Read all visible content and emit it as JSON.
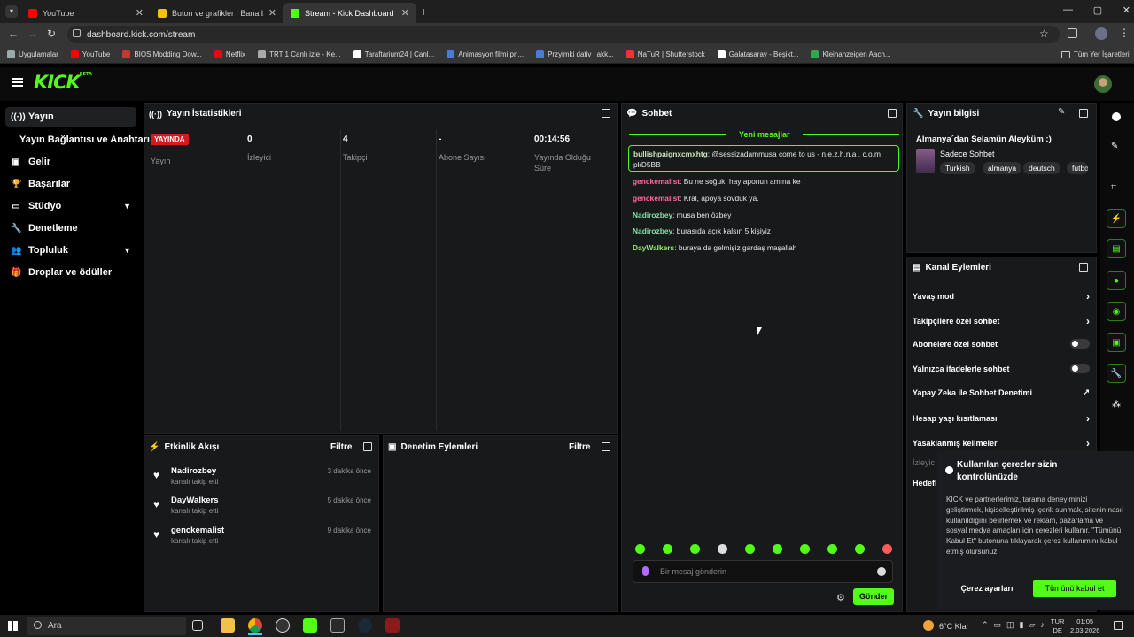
{
  "browser": {
    "tabs": [
      {
        "title": "YouTube",
        "active": false,
        "color": "#ff0000"
      },
      {
        "title": "Buton ve grafikler | Bana bir kal",
        "active": false,
        "color": "#f5c400"
      },
      {
        "title": "Stream - Kick Dashboard",
        "active": true,
        "color": "#53fc18"
      }
    ],
    "url": "dashboard.kick.com/stream",
    "bookmarks": [
      "Uygulamalar",
      "YouTube",
      "BIOS Modding Dow...",
      "Netflix",
      "TRT 1 Canlı izle - Ke...",
      "Taraftarium24 | Canl...",
      "Animasyon filmi pn...",
      "Przyimki dativ i akk...",
      "NaTuR | Shutterstock",
      "Galatasaray - Beşikt...",
      "Kleinanzeigen Aach..."
    ],
    "all_bookmarks": "Tüm Yer İşaretleri"
  },
  "header": {
    "logo": "KICK",
    "logo_badge": "BETA"
  },
  "sidebar": {
    "items": [
      {
        "label": "Yayın",
        "icon": "broadcast-icon",
        "active": true
      },
      {
        "label": "Yayın Bağlantısı ve Anahtarı",
        "icon": "",
        "active": false
      },
      {
        "label": "Gelir",
        "icon": "chart-icon",
        "active": false
      },
      {
        "label": "Başarılar",
        "icon": "trophy-icon",
        "active": false
      },
      {
        "label": "Stüdyo",
        "icon": "studio-icon",
        "active": false,
        "chevron": true
      },
      {
        "label": "Denetleme",
        "icon": "wrench-icon",
        "active": false
      },
      {
        "label": "Topluluk",
        "icon": "community-icon",
        "active": false,
        "chevron": true
      },
      {
        "label": "Droplar ve ödüller",
        "icon": "gift-icon",
        "active": false
      }
    ]
  },
  "stats": {
    "title": "Yayın İstatistikleri",
    "live_badge": "YAYINDA",
    "cols": [
      {
        "value": "",
        "label": "Yayın"
      },
      {
        "value": "0",
        "label": "İzleyici"
      },
      {
        "value": "4",
        "label": "Takipçi"
      },
      {
        "value": "-",
        "label": "Abone Sayısı"
      },
      {
        "value": "00:14:56",
        "label": "Yayında Olduğu Süre"
      }
    ]
  },
  "chat": {
    "title": "Sohbet",
    "new_messages": "Yeni mesajlar",
    "highlight": {
      "user": "bullishpaignxcmxhtg",
      "text": ": @sessizadammusa come to us - n.e.z.h.n.a . c.o.m",
      "text2": "pkD5BB"
    },
    "messages": [
      {
        "user": "genckemalist",
        "text": ": Bu ne soğuk, hay aponun amına ke",
        "color": "#ff6b9d"
      },
      {
        "user": "genckemalist",
        "text": ": Kral, apoya sövdük ya.",
        "color": "#ff6b9d"
      },
      {
        "user": "Nadirozbey",
        "text": ": musa ben özbey",
        "color": "#7ee3a8"
      },
      {
        "user": "Nadirozbey",
        "text": ": burasıda açık kalsın 5 kişiyiz",
        "color": "#7ee3a8"
      },
      {
        "user": "DayWalkers",
        "text": ": buraya da gelmişiz gardaş maşallah",
        "color": "#9cf26a"
      }
    ],
    "placeholder": "Bir mesaj gönderin",
    "send": "Gönder"
  },
  "info": {
    "title": "Yayın bilgisi",
    "stream_title": "Almanya´dan Selamün Aleyküm :)",
    "category": "Sadece Sohbet",
    "tags": [
      "Turkish",
      "almanya",
      "deutsch",
      "futbo"
    ]
  },
  "actions": {
    "title": "Kanal Eylemleri",
    "rows": [
      {
        "label": "Yavaş mod",
        "kind": "chevron"
      },
      {
        "label": "Takipçilere özel sohbet",
        "kind": "chevron"
      },
      {
        "label": "Abonelere özel sohbet",
        "kind": "toggle"
      },
      {
        "label": "Yalnızca ifadelerle sohbet",
        "kind": "toggle"
      },
      {
        "label": "Yapay Zeka ile Sohbet Denetimi",
        "kind": "external"
      },
      {
        "label": "Hesap yaşı kısıtlaması",
        "kind": "chevron"
      },
      {
        "label": "Yasaklanmış kelimeler",
        "kind": "chevron"
      }
    ],
    "partial1": "İzleyic",
    "partial2": "Hedefl"
  },
  "activity": {
    "title": "Etkinlik Akışı",
    "filter": "Filtre",
    "events": [
      {
        "user": "Nadirozbey",
        "sub": "kanalı takip etti",
        "time": "3 dakika önce"
      },
      {
        "user": "DayWalkers",
        "sub": "kanalı takip etti",
        "time": "5 dakika önce"
      },
      {
        "user": "genckemalist",
        "sub": "kanalı takip etti",
        "time": "9 dakika önce"
      }
    ]
  },
  "moderation": {
    "title": "Denetim Eylemleri",
    "filter": "Filtre"
  },
  "cookie": {
    "title": "Kullanılan çerezler sizin kontrolünüzde",
    "body": "KICK ve partnerlerimiz, tarama deneyiminizi geliştirmek, kişiselleştirilmiş içerik sunmak, sitenin nasıl kullanıldığını belirlemek ve reklam, pazarlama ve sosyal medya amaçları için çerezleri kullanır. \"Tümünü Kabul Et\" butonuna tıklayarak çerez kullanımını kabul etmiş olursunuz.",
    "settings": "Çerez ayarları",
    "accept": "Tümünü kabul et"
  },
  "taskbar": {
    "search": "Ara",
    "weather": "6°C  Klar",
    "lang1": "TUR",
    "lang2": "DE",
    "time": "01:05",
    "date": "2.03.2026"
  }
}
